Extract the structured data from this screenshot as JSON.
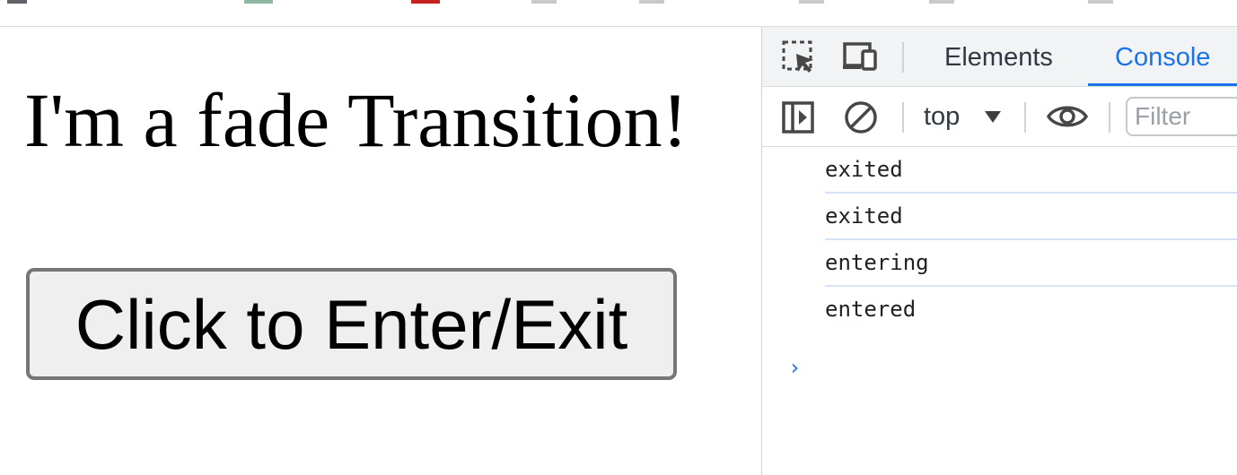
{
  "page": {
    "heading": "I'm a fade Transition!",
    "button_label": "Click to Enter/Exit"
  },
  "devtools": {
    "tabs": [
      {
        "label": "Elements",
        "active": false
      },
      {
        "label": "Console",
        "active": true
      }
    ],
    "toolbar": {
      "context": "top",
      "filter_placeholder": "Filter"
    },
    "console": {
      "messages": [
        "exited",
        "exited",
        "entering",
        "entered"
      ],
      "prompt_symbol": "›"
    }
  },
  "colors": {
    "accent": "#1a73e8",
    "icon": "#474747",
    "button_bg": "#efefef",
    "button_border": "#767676",
    "message_divider": "#d5e3f7"
  },
  "icons": {
    "inspect": "inspect-element-icon",
    "device": "device-toolbar-icon",
    "sidebar": "show-sidebar-icon",
    "clear": "clear-console-icon",
    "eye": "live-expression-eye-icon"
  }
}
